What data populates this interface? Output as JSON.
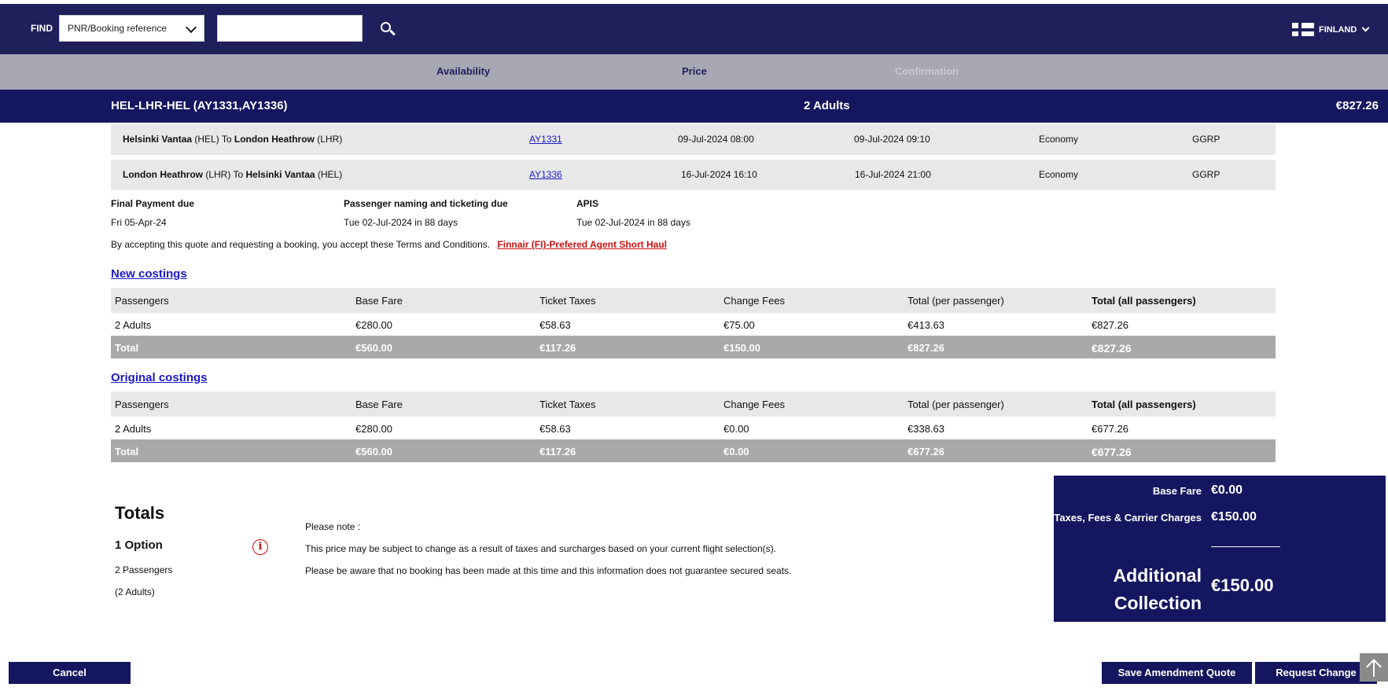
{
  "header": {
    "find_label": "FIND",
    "find_select_value": "PNR/Booking reference",
    "search_input_value": "",
    "country": "FINLAND"
  },
  "steps": [
    "Availability",
    "Price",
    "Confirmation"
  ],
  "route": {
    "title": "HEL-LHR-HEL (AY1331,AY1336)",
    "passengers": "2 Adults",
    "price": "€827.26"
  },
  "segments": [
    {
      "from": "Helsinki Vantaa",
      "from_code": "(HEL)",
      "to_word": "To",
      "to": "London Heathrow",
      "to_code": "(LHR)",
      "flight": "AY1331",
      "depart": "09-Jul-2024 08:00",
      "arrive": "09-Jul-2024 09:10",
      "cabin": "Economy",
      "fare_code": "GGRP"
    },
    {
      "from": "London Heathrow",
      "from_code": "(LHR)",
      "to_word": "To",
      "to": "Helsinki Vantaa",
      "to_code": "(HEL)",
      "flight": "AY1336",
      "depart": "16-Jul-2024 16:10",
      "arrive": "16-Jul-2024 21:00",
      "cabin": "Economy",
      "fare_code": "GGRP"
    }
  ],
  "deadlines": [
    {
      "label": "Final Payment due",
      "value": "Fri 05-Apr-24"
    },
    {
      "label": "Passenger naming and ticketing due",
      "value": "Tue 02-Jul-2024 in 88 days"
    },
    {
      "label": "APIS",
      "value": "Tue 02-Jul-2024 in 88 days"
    }
  ],
  "terms": {
    "text": "By accepting this quote and requesting a booking, you accept these Terms and Conditions.",
    "link": "Finnair (FI)-Prefered Agent Short Haul"
  },
  "new_costings": {
    "title": "New costings",
    "headers": [
      "Passengers",
      "Base Fare",
      "Ticket Taxes",
      "Change Fees",
      "Total (per passenger)",
      "Total (all passengers)"
    ],
    "row": [
      "2 Adults",
      "€280.00",
      "€58.63",
      "€75.00",
      "€413.63",
      "€827.26"
    ],
    "total": [
      "Total",
      "€560.00",
      "€117.26",
      "€150.00",
      "€827.26",
      "€827.26"
    ]
  },
  "original_costings": {
    "title": "Original costings",
    "headers": [
      "Passengers",
      "Base Fare",
      "Ticket Taxes",
      "Change Fees",
      "Total (per passenger)",
      "Total (all passengers)"
    ],
    "row": [
      "2 Adults",
      "€280.00",
      "€58.63",
      "€0.00",
      "€338.63",
      "€677.26"
    ],
    "total": [
      "Total",
      "€560.00",
      "€117.26",
      "€0.00",
      "€677.26",
      "€677.26"
    ]
  },
  "totals": {
    "title": "Totals",
    "option": "1 Option",
    "passengers": "2 Passengers",
    "adults": "(2 Adults)",
    "notes": [
      "Please note :",
      "This price may be subject to change as a result of taxes and surcharges based on your current flight selection(s).",
      "Please be aware that no booking has been made at this time and this information does not guarantee secured seats."
    ]
  },
  "summary": {
    "base_fare_label": "Base Fare",
    "base_fare_value": "€0.00",
    "taxes_label": "Taxes, Fees & Carrier Charges",
    "taxes_value": "€150.00",
    "additional_label_1": "Additional",
    "additional_label_2": "Collection",
    "additional_value": "€150.00"
  },
  "buttons": {
    "cancel": "Cancel",
    "save": "Save Amendment Quote",
    "request": "Request Change"
  },
  "colors": {
    "navy": "#1f1f5c",
    "dark_navy": "#14165f",
    "link_red": "#cc1111",
    "link_blue": "#1a1acc"
  }
}
